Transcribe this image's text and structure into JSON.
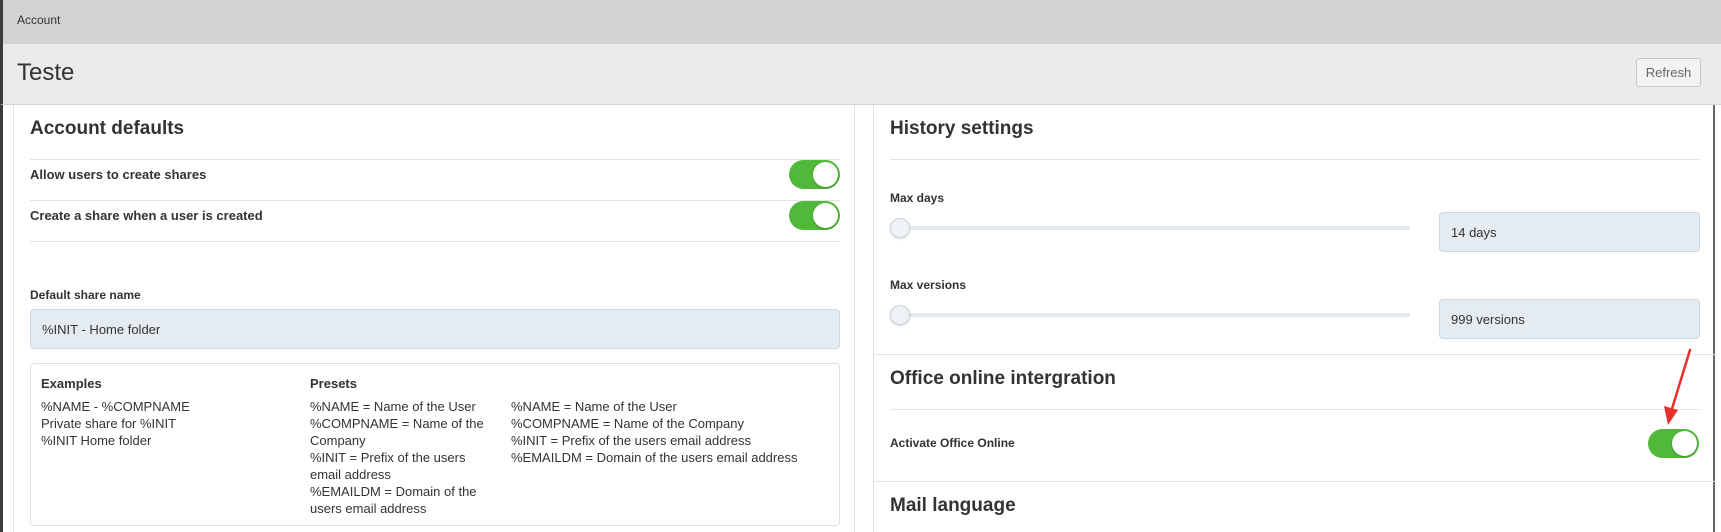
{
  "breadcrumb": "Account",
  "page_title": "Teste",
  "refresh_label": "Refresh",
  "account_defaults": {
    "title": "Account defaults",
    "allow_shares_label": "Allow users to create shares",
    "allow_shares_on": true,
    "create_share_label": "Create a share when a user is created",
    "create_share_on": true,
    "default_share_name_label": "Default share name",
    "default_share_name_value": "%INIT - Home folder",
    "examples_title": "Examples",
    "examples": [
      "%NAME - %COMPNAME",
      "Private share for %INIT",
      "%INIT Home folder"
    ],
    "presets_title": "Presets",
    "presets_col1": [
      "%NAME = Name of the User",
      "%COMPNAME = Name of the Company",
      "%INIT = Prefix of the users email address",
      "%EMAILDM = Domain of the users email address"
    ],
    "presets_col2": [
      "%NAME = Name of the User",
      "%COMPNAME = Name of the Company",
      "%INIT = Prefix of the users email address",
      "%EMAILDM = Domain of the users email address"
    ]
  },
  "history": {
    "title": "History settings",
    "max_days_label": "Max days",
    "max_days_value": "14 days",
    "max_days_fraction": 0.0,
    "max_versions_label": "Max versions",
    "max_versions_value": "999 versions",
    "max_versions_fraction": 0.0
  },
  "office": {
    "title": "Office online intergration",
    "activate_label": "Activate Office Online",
    "activate_on": true
  },
  "mail": {
    "title": "Mail language"
  },
  "colors": {
    "toggle_on": "#51b93a",
    "field_bg": "#e4ebf1",
    "annotation_arrow": "#e8302a"
  }
}
